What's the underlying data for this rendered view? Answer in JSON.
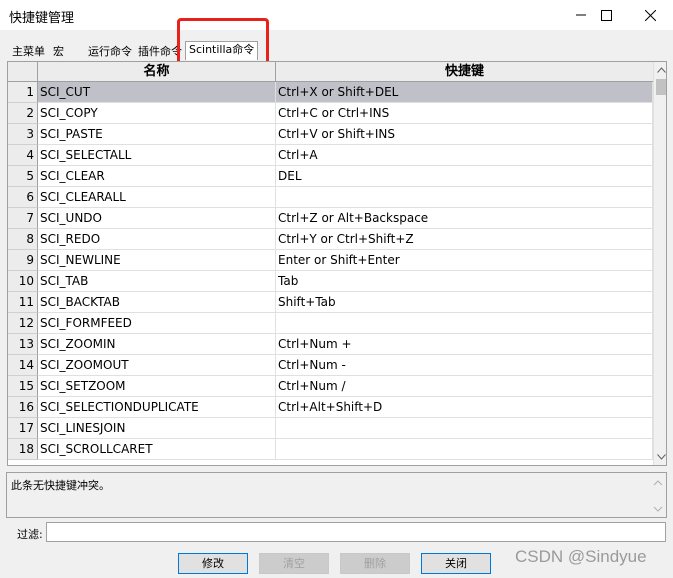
{
  "window": {
    "title": "快捷键管理"
  },
  "tabs": [
    {
      "label": "主菜单"
    },
    {
      "label": "宏"
    },
    {
      "label": "运行命令"
    },
    {
      "label": "插件命令"
    },
    {
      "label": "Scintilla命令"
    }
  ],
  "grid": {
    "headers": {
      "name": "名称",
      "shortcut": "快捷键"
    },
    "rows": [
      {
        "num": "1",
        "name": "SCI_CUT",
        "shortcut": "Ctrl+X or Shift+DEL"
      },
      {
        "num": "2",
        "name": "SCI_COPY",
        "shortcut": "Ctrl+C or Ctrl+INS"
      },
      {
        "num": "3",
        "name": "SCI_PASTE",
        "shortcut": "Ctrl+V or Shift+INS"
      },
      {
        "num": "4",
        "name": "SCI_SELECTALL",
        "shortcut": "Ctrl+A"
      },
      {
        "num": "5",
        "name": "SCI_CLEAR",
        "shortcut": "DEL"
      },
      {
        "num": "6",
        "name": "SCI_CLEARALL",
        "shortcut": ""
      },
      {
        "num": "7",
        "name": "SCI_UNDO",
        "shortcut": "Ctrl+Z or Alt+Backspace"
      },
      {
        "num": "8",
        "name": "SCI_REDO",
        "shortcut": "Ctrl+Y or Ctrl+Shift+Z"
      },
      {
        "num": "9",
        "name": "SCI_NEWLINE",
        "shortcut": "Enter or Shift+Enter"
      },
      {
        "num": "10",
        "name": "SCI_TAB",
        "shortcut": "Tab"
      },
      {
        "num": "11",
        "name": "SCI_BACKTAB",
        "shortcut": "Shift+Tab"
      },
      {
        "num": "12",
        "name": "SCI_FORMFEED",
        "shortcut": ""
      },
      {
        "num": "13",
        "name": "SCI_ZOOMIN",
        "shortcut": "Ctrl+Num +"
      },
      {
        "num": "14",
        "name": "SCI_ZOOMOUT",
        "shortcut": "Ctrl+Num -"
      },
      {
        "num": "15",
        "name": "SCI_SETZOOM",
        "shortcut": "Ctrl+Num /"
      },
      {
        "num": "16",
        "name": "SCI_SELECTIONDUPLICATE",
        "shortcut": "Ctrl+Alt+Shift+D"
      },
      {
        "num": "17",
        "name": "SCI_LINESJOIN",
        "shortcut": ""
      },
      {
        "num": "18",
        "name": "SCI_SCROLLCARET",
        "shortcut": ""
      }
    ]
  },
  "message": "此条无快捷键冲突。",
  "filter": {
    "label": "过滤:",
    "value": ""
  },
  "buttons": {
    "modify": "修改",
    "clear": "清空",
    "delete": "删除",
    "close": "关闭"
  },
  "watermark": "CSDN @Sindyue",
  "colors": {
    "highlight_box": "#e8221b",
    "selected_row": "#c0c0c8"
  }
}
